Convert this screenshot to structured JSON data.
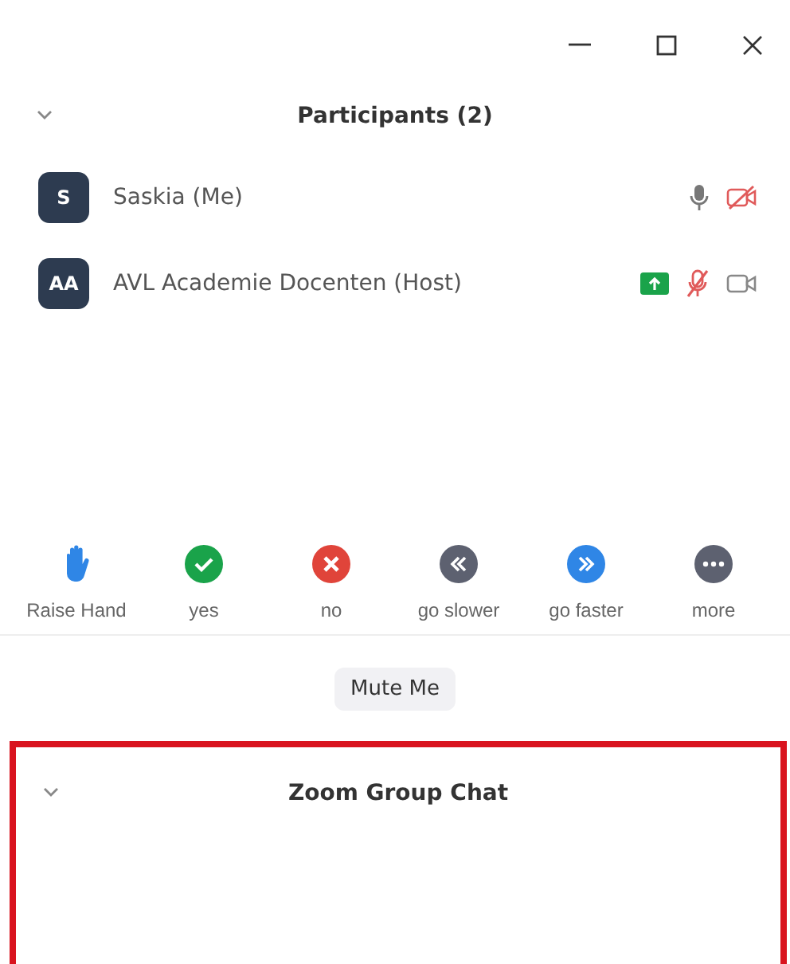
{
  "participants_panel": {
    "title": "Participants (2)",
    "expanded": true
  },
  "participants": [
    {
      "initials": "S",
      "name": "Saskia (Me)",
      "sharing": false,
      "audio_muted": false,
      "video_on": false
    },
    {
      "initials": "AA",
      "name": "AVL Academie Docenten (Host)",
      "sharing": true,
      "audio_muted": true,
      "video_on": true
    }
  ],
  "reactions": [
    {
      "kind": "hand",
      "label": "Raise Hand"
    },
    {
      "kind": "yes",
      "label": "yes"
    },
    {
      "kind": "no",
      "label": "no"
    },
    {
      "kind": "slower",
      "label": "go slower"
    },
    {
      "kind": "faster",
      "label": "go faster"
    },
    {
      "kind": "more",
      "label": "more"
    }
  ],
  "mute_button": "Mute Me",
  "chat_panel": {
    "title": "Zoom Group Chat",
    "expanded": true,
    "highlighted": true
  }
}
